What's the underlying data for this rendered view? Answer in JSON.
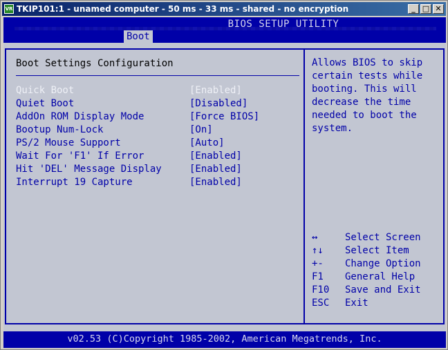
{
  "window": {
    "icon_label": "VR",
    "title": "TKIP101:1 - unamed computer - 50 ms - 33 ms - shared - no encryption",
    "minimize": "_",
    "maximize": "□",
    "close": "✕"
  },
  "bios": {
    "title": "BIOS SETUP UTILITY",
    "active_tab": "Boot",
    "section_title": "Boot Settings Configuration",
    "settings": [
      {
        "label": "Quick Boot",
        "value": "[Enabled]",
        "selected": true
      },
      {
        "label": "Quiet Boot",
        "value": "[Disabled]",
        "selected": false
      },
      {
        "label": "AddOn ROM Display Mode",
        "value": "[Force BIOS]",
        "selected": false
      },
      {
        "label": "Bootup Num-Lock",
        "value": "[On]",
        "selected": false
      },
      {
        "label": "PS/2 Mouse Support",
        "value": "[Auto]",
        "selected": false
      },
      {
        "label": "Wait For 'F1' If Error",
        "value": "[Enabled]",
        "selected": false
      },
      {
        "label": "Hit 'DEL' Message Display",
        "value": "[Enabled]",
        "selected": false
      },
      {
        "label": "Interrupt 19 Capture",
        "value": "[Enabled]",
        "selected": false
      }
    ],
    "help_text": "Allows BIOS to skip\ncertain tests while\nbooting. This will\ndecrease the time\nneeded to boot the\nsystem.",
    "keys": [
      {
        "key": "↔",
        "action": "Select Screen"
      },
      {
        "key": "↑↓",
        "action": "Select Item"
      },
      {
        "key": "+-",
        "action": "Change Option"
      },
      {
        "key": "F1",
        "action": "General Help"
      },
      {
        "key": "F10",
        "action": "Save and Exit"
      },
      {
        "key": "ESC",
        "action": "Exit"
      }
    ],
    "footer": "v02.53 (C)Copyright 1985-2002, American Megatrends, Inc."
  }
}
